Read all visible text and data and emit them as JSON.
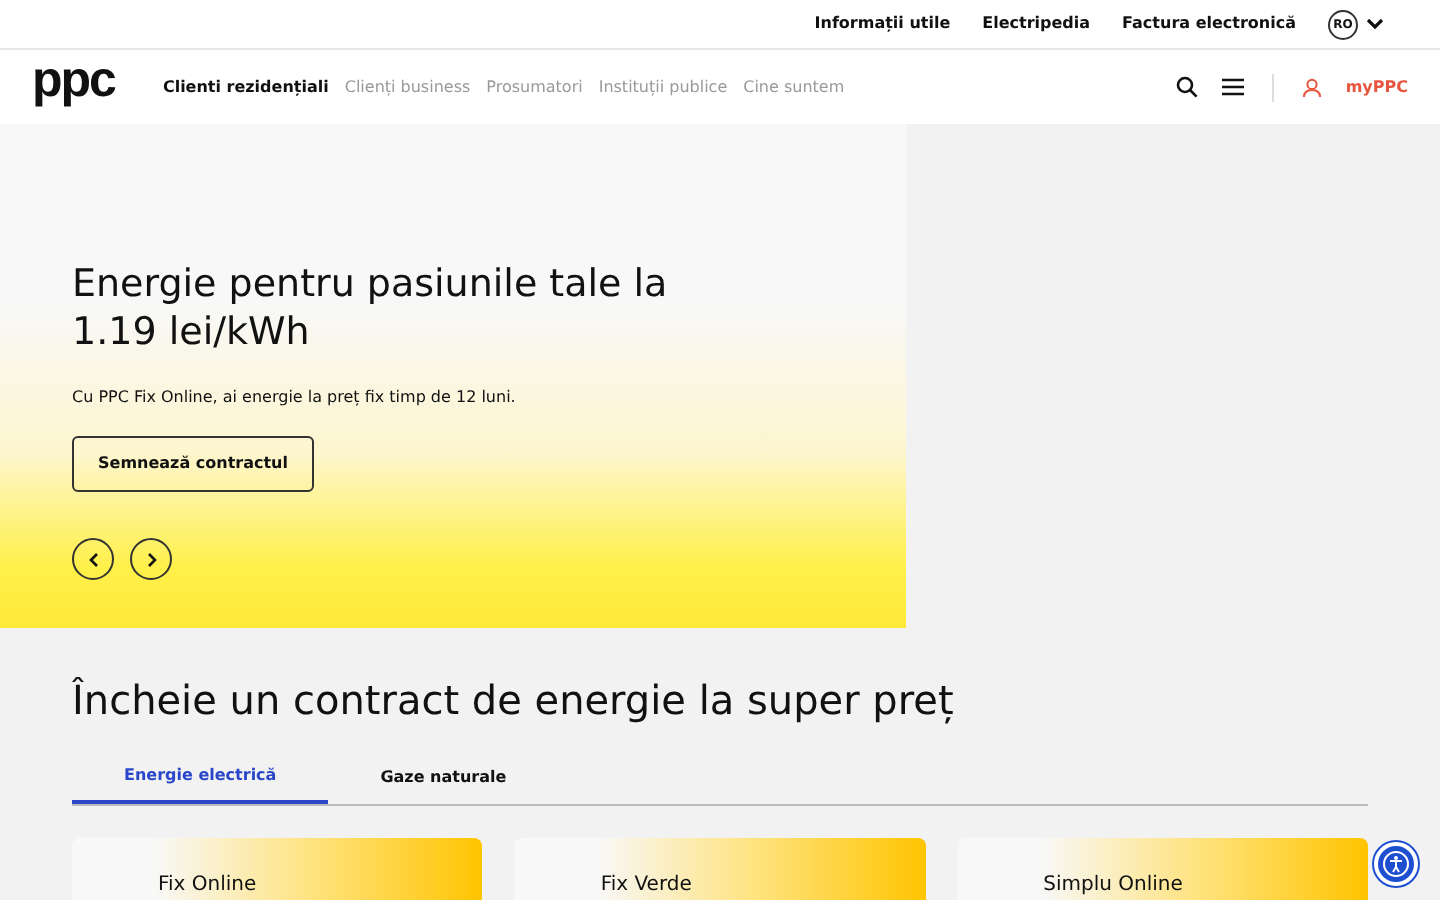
{
  "top_links": [
    "Informații utile",
    "Electripedia",
    "Factura electronică"
  ],
  "language": "RO",
  "logo": "ppc",
  "nav": [
    {
      "label": "Clienti rezidențiali",
      "selected": true
    },
    {
      "label": "Clienți business",
      "selected": false
    },
    {
      "label": "Prosumatori",
      "selected": false
    },
    {
      "label": "Instituții publice",
      "selected": false
    },
    {
      "label": "Cine suntem",
      "selected": false
    }
  ],
  "account_link": "myPPC",
  "hero": {
    "title": "Energie pentru pasiunile tale la 1.19 lei/kWh",
    "text": "Cu PPC Fix Online, ai energie la preț fix timp de 12 luni.",
    "button": "Semnează contractul"
  },
  "section_title": "Încheie un contract de energie la super preț",
  "tabs": [
    {
      "label": "Energie electrică",
      "selected": true
    },
    {
      "label": "Gaze naturale",
      "selected": false
    }
  ],
  "offers": [
    "Fix Online",
    "Fix Verde",
    "Simplu Online"
  ]
}
